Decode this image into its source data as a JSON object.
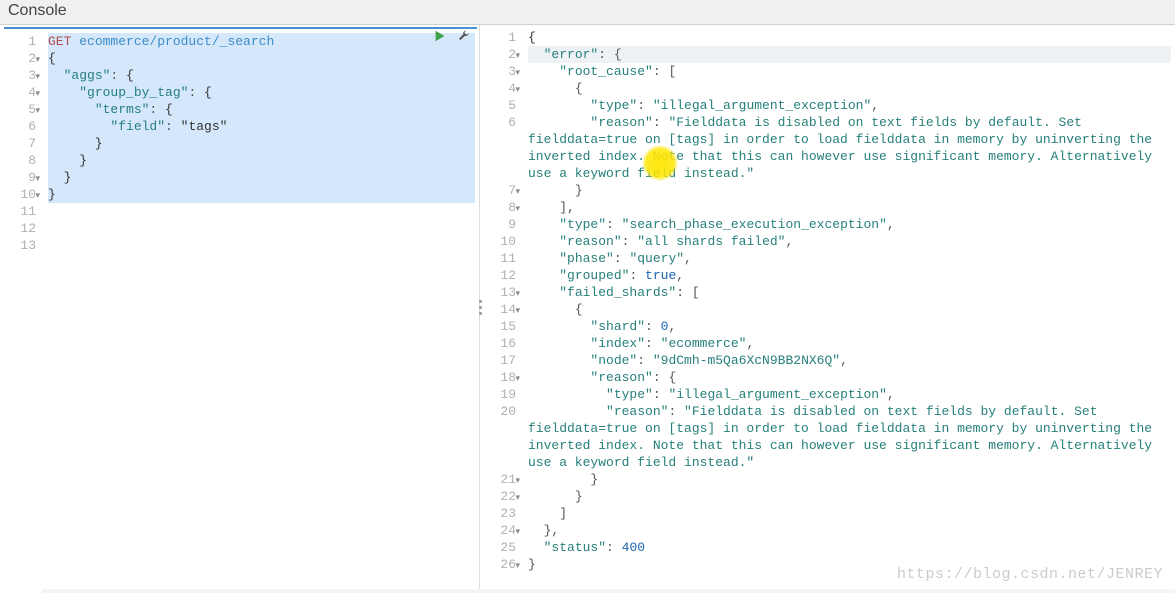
{
  "header": {
    "title": "Console"
  },
  "watermark": "https://blog.csdn.net/JENREY",
  "request": {
    "method": "GET",
    "path": "ecommerce/product/_search",
    "body_lines": [
      "{",
      "  \"aggs\": {",
      "    \"group_by_tag\": {",
      "      \"terms\": {",
      "        \"field\": \"tags\"",
      "      }",
      "    }",
      "  }",
      "}"
    ]
  },
  "left_gutter": {
    "lines": [
      "1",
      "2",
      "3",
      "4",
      "5",
      "6",
      "7",
      "8",
      "9",
      "10",
      "11",
      "12",
      "13"
    ],
    "fold_rows": [
      2,
      3,
      4,
      5,
      9,
      10
    ]
  },
  "right_gutter": {
    "lines": [
      "1",
      "2",
      "3",
      "4",
      "5",
      "6",
      "7",
      "8",
      "9",
      "10",
      "11",
      "12",
      "13",
      "14",
      "15",
      "16",
      "17",
      "18",
      "19",
      "20",
      "21",
      "22",
      "23",
      "24",
      "25",
      "26"
    ],
    "fold_rows": [
      2,
      3,
      4,
      7,
      8,
      13,
      14,
      18,
      21,
      22,
      24,
      26
    ]
  },
  "response": {
    "error": {
      "root_cause": [
        {
          "type": "illegal_argument_exception",
          "reason": "Fielddata is disabled on text fields by default. Set fielddata=true on [tags] in order to load fielddata in memory by uninverting the inverted index. Note that this can however use significant memory. Alternatively use a keyword field instead."
        }
      ],
      "type": "search_phase_execution_exception",
      "reason": "all shards failed",
      "phase": "query",
      "grouped": true,
      "failed_shards": [
        {
          "shard": 0,
          "index": "ecommerce",
          "node": "9dCmh-m5Qa6XcN9BB2NX6Q",
          "reason": {
            "type": "illegal_argument_exception",
            "reason": "Fielddata is disabled on text fields by default. Set fielddata=true on [tags] in order to load fielddata in memory by uninverting the inverted index. Note that this can however use significant memory. Alternatively use a keyword field instead."
          }
        }
      ]
    },
    "status": 400
  },
  "icons": {
    "run": "run",
    "wrench": "settings"
  }
}
